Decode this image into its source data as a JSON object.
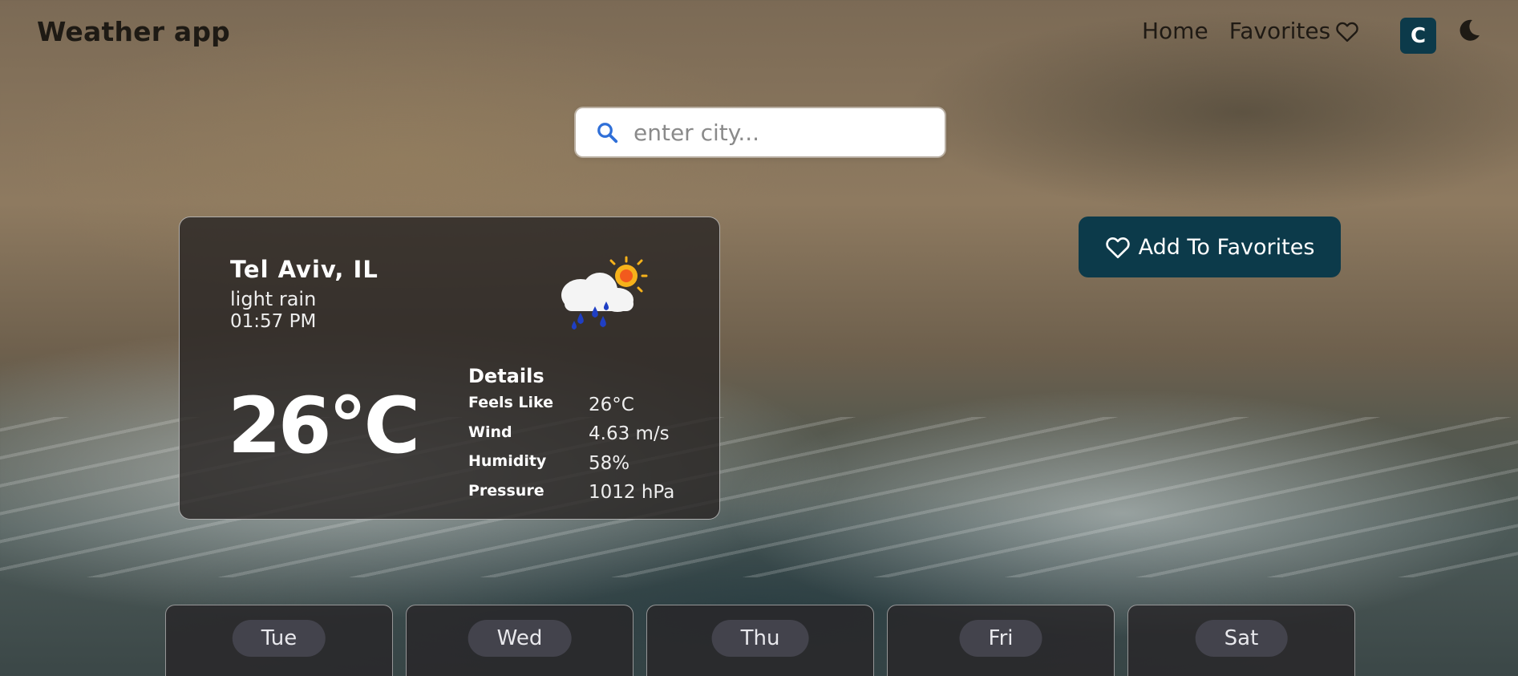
{
  "header": {
    "app_title": "Weather app",
    "nav": {
      "home": "Home",
      "favorites": "Favorites"
    },
    "avatar_initial": "C"
  },
  "search": {
    "placeholder": "enter city..."
  },
  "current": {
    "city": "Tel Aviv, IL",
    "description": "light rain",
    "time": "01:57 PM",
    "temperature": "26°C",
    "icon": "rain-with-sun-icon",
    "details_title": "Details",
    "details": [
      {
        "label": "Feels Like",
        "value": "26°C"
      },
      {
        "label": "Wind",
        "value": "4.63 m/s"
      },
      {
        "label": "Humidity",
        "value": "58%"
      },
      {
        "label": "Pressure",
        "value": "1012 hPa"
      }
    ]
  },
  "favorite_button": {
    "label": "Add To Favorites"
  },
  "forecast": [
    {
      "day": "Tue"
    },
    {
      "day": "Wed"
    },
    {
      "day": "Thu"
    },
    {
      "day": "Fri"
    },
    {
      "day": "Sat"
    }
  ],
  "colors": {
    "accent": "#0c3a4a",
    "search_icon": "#2f6fd8"
  }
}
